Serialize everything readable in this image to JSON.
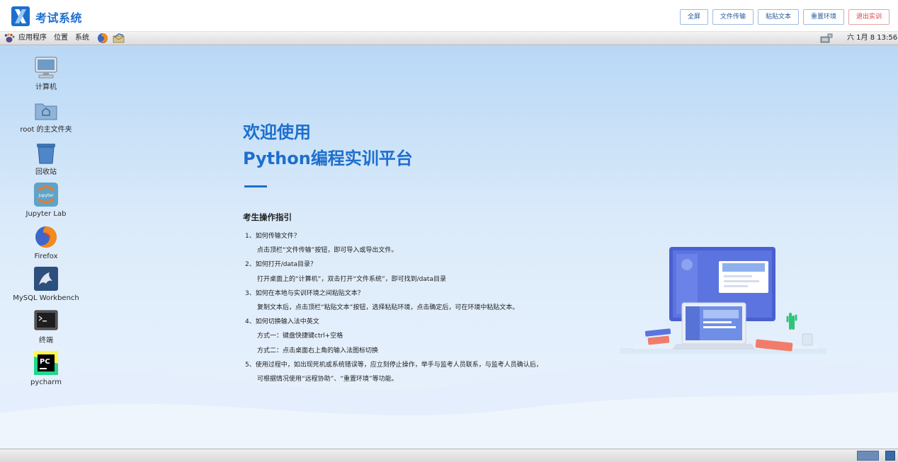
{
  "header": {
    "title": "考试系统",
    "buttons": [
      "全屏",
      "文件传输",
      "粘贴文本",
      "重置环境",
      "退出实训"
    ]
  },
  "panel": {
    "menu_apps": "应用程序",
    "menu_places": "位置",
    "menu_system": "系统",
    "clock": "六 1月  8 13:56"
  },
  "desktop_icons": [
    {
      "label": "计算机",
      "icon": "computer-icon"
    },
    {
      "label": "root 的主文件夹",
      "icon": "home-folder-icon"
    },
    {
      "label": "回收站",
      "icon": "trash-icon"
    },
    {
      "label": "Jupyter Lab",
      "icon": "jupyter-icon"
    },
    {
      "label": "Firefox",
      "icon": "firefox-icon"
    },
    {
      "label": "MySQL Workbench",
      "icon": "mysql-workbench-icon"
    },
    {
      "label": "终端",
      "icon": "terminal-icon"
    },
    {
      "label": "pycharm",
      "icon": "pycharm-icon"
    }
  ],
  "welcome": {
    "line1": "欢迎使用",
    "line2": "Python编程实训平台",
    "guide_title": "考生操作指引",
    "guide_lines": [
      "1、如何传输文件？",
      "点击顶栏“文件传输”按钮，即可导入或导出文件。",
      "2、如何打开/data目录？",
      "打开桌面上的“计算机”，双击打开“文件系统”，即可找到/data目录",
      "3、如何在本地与实训环境之间粘贴文本？",
      "复制文本后，点击顶栏“粘贴文本”按钮，选择粘贴环境，点击确定后，可在环境中粘贴文本。",
      "4、如何切换输入法中英文",
      "方式一：键盘快捷键ctrl+空格",
      "方式二：点击桌面右上角的输入法图标切换",
      "5、使用过程中，如出现死机或系统错误等，应立刻停止操作，举手与监考人员联系，与监考人员确认后，",
      "可根据情况使用“远程协助”、“重置环境”等功能。"
    ]
  },
  "colors": {
    "accent": "#1d6fce",
    "danger": "#d04040"
  }
}
